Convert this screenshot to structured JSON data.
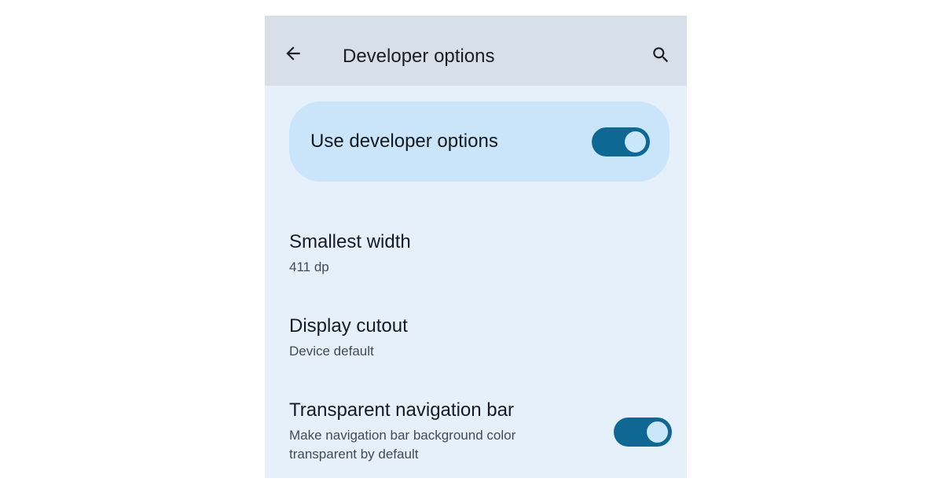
{
  "appbar": {
    "title": "Developer options",
    "back_icon": "arrow-back-icon",
    "search_icon": "search-icon"
  },
  "master_switch": {
    "label": "Use developer options",
    "checked": true
  },
  "preferences": [
    {
      "title": "Smallest width",
      "summary": "411 dp"
    },
    {
      "title": "Display cutout",
      "summary": "Device default"
    },
    {
      "title": "Transparent navigation bar",
      "summary": "Make navigation bar background color transparent by default",
      "checked": true
    }
  ],
  "colors": {
    "appbar_background": "#d7dfe8",
    "page_background": "#e6f0fb",
    "master_card_background": "#cae4f9",
    "toggle_track_on": "#0f6793",
    "toggle_thumb_on": "#c9e6fb"
  }
}
